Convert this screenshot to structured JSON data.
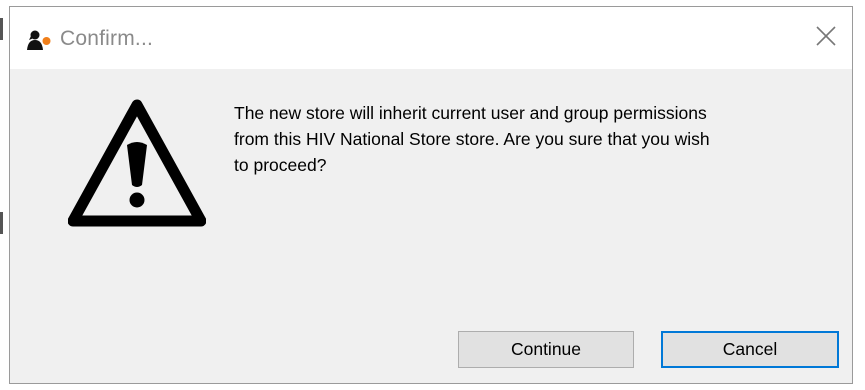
{
  "dialog": {
    "title": "Confirm...",
    "app_icon": "user-orange-dot-icon",
    "close_icon": "close-icon",
    "warning_icon": "warning-triangle-icon",
    "message_lines": [
      "The new store will inherit current user and group permissions",
      "from this HIV National Store store. Are you sure that you wish",
      "to proceed?"
    ],
    "buttons": {
      "continue_label": "Continue",
      "cancel_label": "Cancel"
    },
    "colors": {
      "focus_border": "#0078d7",
      "app_icon_accent": "#f07f1a"
    }
  }
}
